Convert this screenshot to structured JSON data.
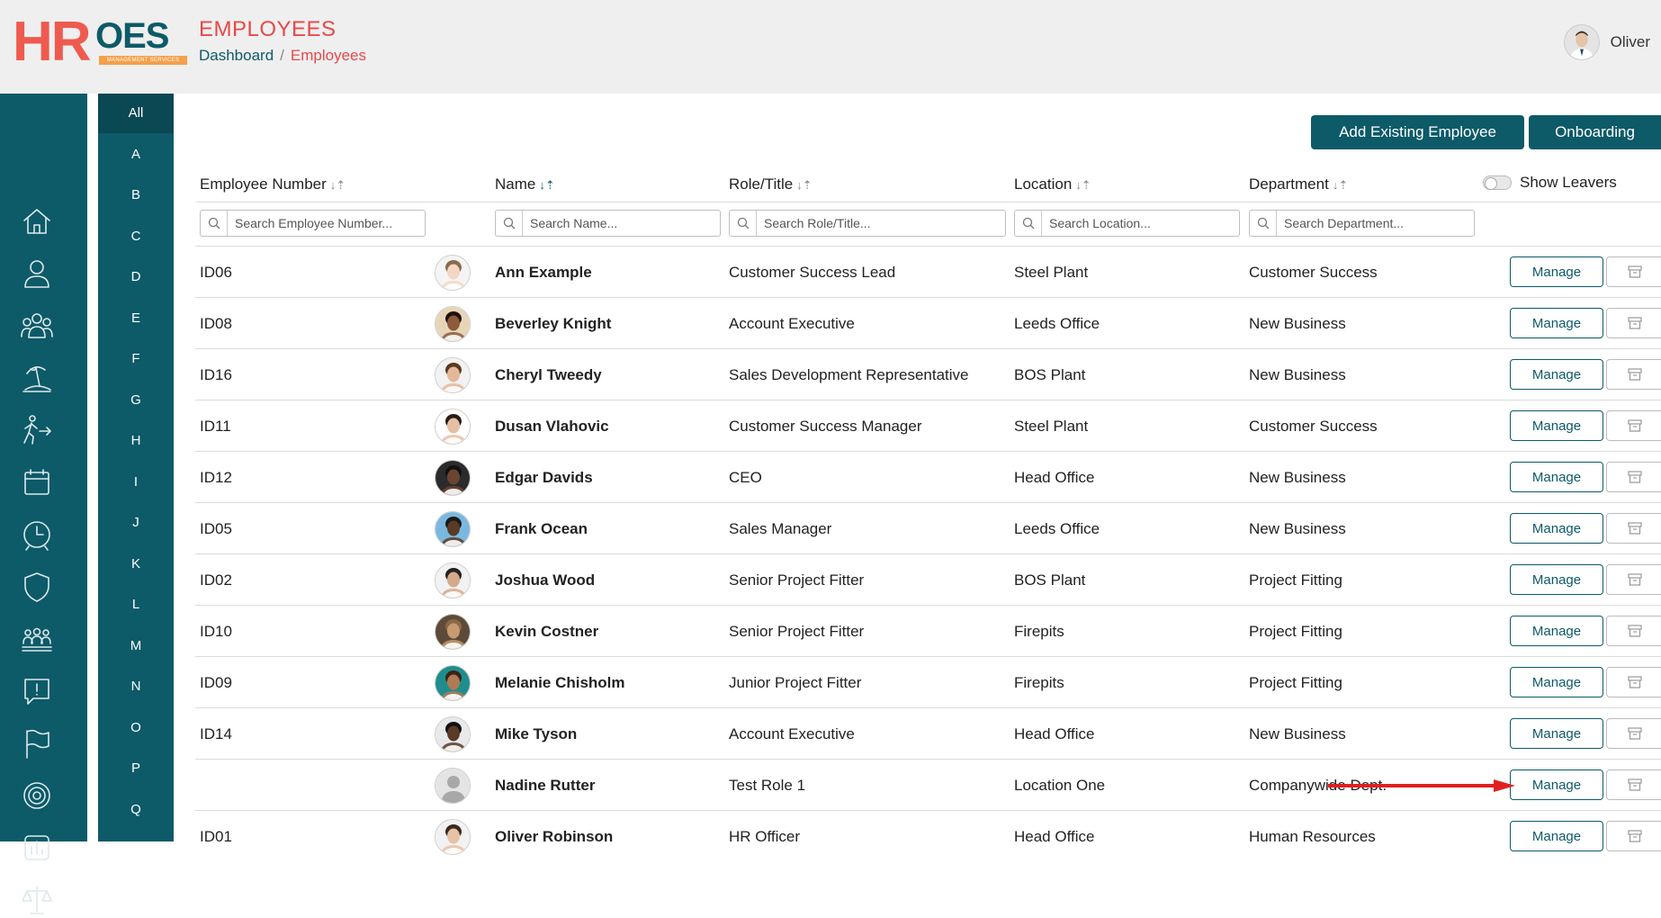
{
  "brand": {
    "logo_hr": "HR",
    "logo_oes": "OES",
    "logo_sub": "MANAGEMENT SERVICES",
    "primary": "#0d5a68",
    "accent": "#e84848"
  },
  "header": {
    "title": "EMPLOYEES",
    "breadcrumb": {
      "home": "Dashboard",
      "separator": "/",
      "current": "Employees"
    },
    "user": "Oliver"
  },
  "sidebar": {
    "icons": [
      "home-icon",
      "user-icon",
      "users-icon",
      "holiday-icon",
      "leaver-icon",
      "calendar-icon",
      "clock-icon",
      "shield-icon",
      "team-icon",
      "alert-icon",
      "flag-icon",
      "target-icon",
      "report-icon",
      "scales-icon"
    ]
  },
  "alphabet": [
    "All",
    "A",
    "B",
    "C",
    "D",
    "E",
    "F",
    "G",
    "H",
    "I",
    "J",
    "K",
    "L",
    "M",
    "N",
    "O",
    "P",
    "Q"
  ],
  "actions": {
    "add_existing": "Add Existing Employee",
    "onboarding": "Onboarding"
  },
  "columns": {
    "number": "Employee Number",
    "name": "Name",
    "role": "Role/Title",
    "location": "Location",
    "department": "Department"
  },
  "show_leavers": {
    "label": "Show Leavers",
    "on": false
  },
  "search": {
    "number": "Search Employee Number...",
    "name": "Search Name...",
    "role": "Search Role/Title...",
    "location": "Search Location...",
    "department": "Search Department..."
  },
  "row_button": "Manage",
  "employees": [
    {
      "id": "ID06",
      "name": "Ann Example",
      "role": "Customer Success Lead",
      "location": "Steel Plant",
      "department": "Customer Success",
      "skin": "#f3d7c4",
      "hair": "#8a6b4e",
      "bg": "#f4f4f4"
    },
    {
      "id": "ID08",
      "name": "Beverley Knight",
      "role": "Account Executive",
      "location": "Leeds Office",
      "department": "New Business",
      "skin": "#8d5a3b",
      "hair": "#1d120c",
      "bg": "#e8d5b8"
    },
    {
      "id": "ID16",
      "name": "Cheryl Tweedy",
      "role": "Sales Development Representative",
      "location": "BOS Plant",
      "department": "New Business",
      "skin": "#e3b999",
      "hair": "#5a3b22",
      "bg": "#f2f2f2"
    },
    {
      "id": "ID11",
      "name": "Dusan Vlahovic",
      "role": "Customer Success Manager",
      "location": "Steel Plant",
      "department": "Customer Success",
      "skin": "#e6c0a4",
      "hair": "#2a1c12",
      "bg": "#ffffff"
    },
    {
      "id": "ID12",
      "name": "Edgar Davids",
      "role": "CEO",
      "location": "Head Office",
      "department": "New Business",
      "skin": "#6b4530",
      "hair": "#111111",
      "bg": "#2b2b2b"
    },
    {
      "id": "ID05",
      "name": "Frank Ocean",
      "role": "Sales Manager",
      "location": "Leeds Office",
      "department": "New Business",
      "skin": "#5a3a26",
      "hair": "#1a1a1a",
      "bg": "#7bb8e0"
    },
    {
      "id": "ID02",
      "name": "Joshua Wood",
      "role": "Senior Project Fitter",
      "location": "BOS Plant",
      "department": "Project Fitting",
      "skin": "#d6a98a",
      "hair": "#222222",
      "bg": "#f2f2f2"
    },
    {
      "id": "ID10",
      "name": "Kevin Costner",
      "role": "Senior Project Fitter",
      "location": "Firepits",
      "department": "Project Fitting",
      "skin": "#c79a72",
      "hair": "#8a6a45",
      "bg": "#5e4a38"
    },
    {
      "id": "ID09",
      "name": "Melanie Chisholm",
      "role": "Junior Project Fitter",
      "location": "Firepits",
      "department": "Project Fitting",
      "skin": "#b07a55",
      "hair": "#3a2414",
      "bg": "#1f8d8d"
    },
    {
      "id": "ID14",
      "name": "Mike Tyson",
      "role": "Account Executive",
      "location": "Head Office",
      "department": "New Business",
      "skin": "#5b3a26",
      "hair": "#111111",
      "bg": "#e9e9e9"
    },
    {
      "id": "",
      "name": "Nadine Rutter",
      "role": "Test Role 1",
      "location": "Location One",
      "department": "Companywide Dept.",
      "skin": "placeholder",
      "hair": "",
      "bg": "#e4e4e4"
    },
    {
      "id": "ID01",
      "name": "Oliver Robinson",
      "role": "HR Officer",
      "location": "Head Office",
      "department": "Human Resources",
      "skin": "#e6c2a6",
      "hair": "#3a2a1e",
      "bg": "#f2f2f2"
    }
  ]
}
